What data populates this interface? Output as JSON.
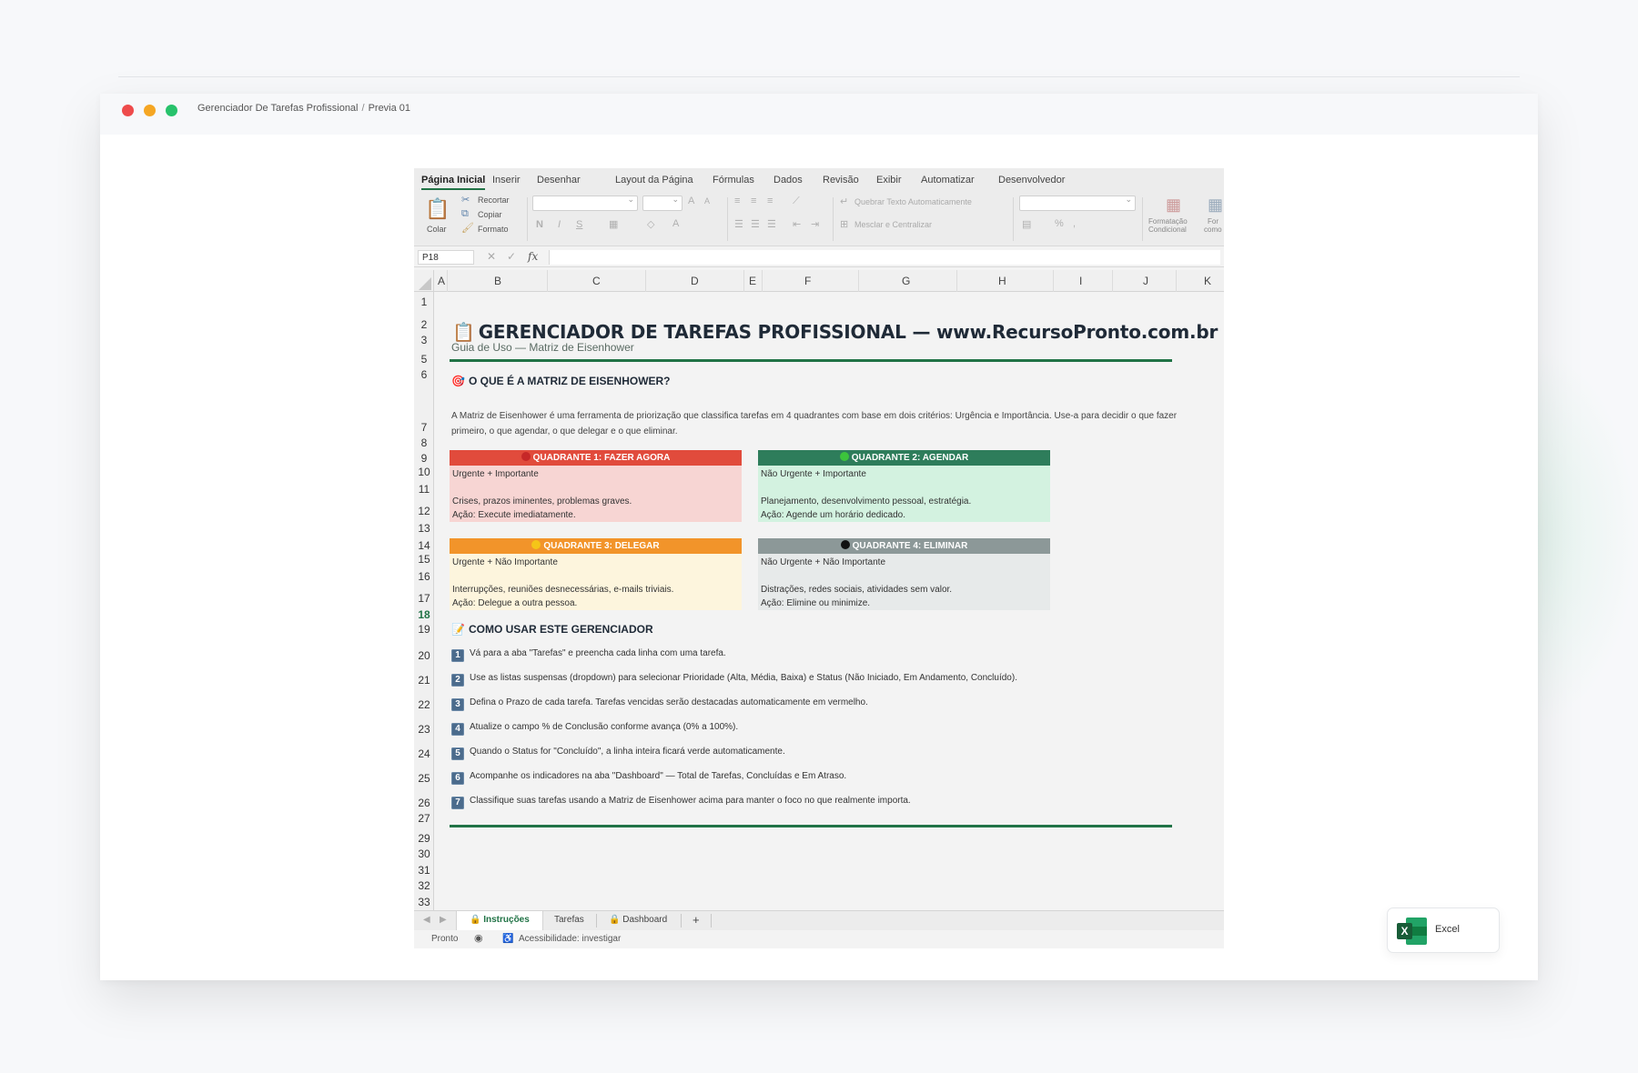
{
  "window": {
    "title": "Gerenciador De Tarefas Profissional",
    "separator": "/",
    "subtitle": "Previa 01"
  },
  "ribbon_tabs": [
    "Página Inicial",
    "Inserir",
    "Desenhar",
    "Layout da Página",
    "Fórmulas",
    "Dados",
    "Revisão",
    "Exibir",
    "Automatizar",
    "Desenvolvedor"
  ],
  "ribbon": {
    "paste": "Colar",
    "cut": "Recortar",
    "copy": "Copiar",
    "format": "Formato",
    "wrap_text": "Quebrar Texto Automaticamente",
    "merge_center": "Mesclar e Centralizar",
    "conditional_formatting_1": "Formatação",
    "conditional_formatting_2": "Condicional",
    "format_as_1": "For",
    "format_as_2": "como"
  },
  "formula_bar": {
    "cell_ref": "P18",
    "fx": "fx"
  },
  "columns": [
    "A",
    "B",
    "C",
    "D",
    "E",
    "F",
    "G",
    "H",
    "I",
    "J",
    "K"
  ],
  "rows": [
    "1",
    "2",
    "3",
    "5",
    "6",
    "7",
    "8",
    "9",
    "10",
    "11",
    "12",
    "13",
    "14",
    "15",
    "16",
    "17",
    "18",
    "19",
    "20",
    "21",
    "22",
    "23",
    "24",
    "25",
    "26",
    "27",
    "29",
    "30",
    "31",
    "32",
    "33"
  ],
  "selected_row": "18",
  "sheet": {
    "title_icon": "📋",
    "title": "GERENCIADOR DE TAREFAS PROFISSIONAL — www.RecursoPronto.com.br",
    "subtitle": "Guia de Uso — Matriz de Eisenhower",
    "section1_icon": "🎯",
    "section1_title": "O QUE É A MATRIZ DE EISENHOWER?",
    "description": "A Matriz de Eisenhower é uma ferramenta de priorização que classifica tarefas em 4 quadrantes com base em dois critérios: Urgência e Importância. Use-a para decidir o que fazer primeiro, o que agendar, o que delegar e o que eliminar.",
    "quadrants": [
      {
        "title": "QUADRANTE 1: FAZER AGORA",
        "line1": "Urgente + Importante",
        "line2": "Crises, prazos iminentes, problemas graves.",
        "line3": "Ação: Execute imediatamente.",
        "header_color": "#e14b3c",
        "body_color": "#f7d5d3",
        "dot_color": "#c62828"
      },
      {
        "title": "QUADRANTE 2: AGENDAR",
        "line1": "Não Urgente + Importante",
        "line2": "Planejamento, desenvolvimento pessoal, estratégia.",
        "line3": "Ação: Agende um horário dedicado.",
        "header_color": "#2e7d5b",
        "body_color": "#d3f2e0",
        "dot_color": "#3cc43c"
      },
      {
        "title": "QUADRANTE 3: DELEGAR",
        "line1": "Urgente + Não Importante",
        "line2": "Interrupções, reuniões desnecessárias, e-mails triviais.",
        "line3": "Ação: Delegue a outra pessoa.",
        "header_color": "#f2942a",
        "body_color": "#fdf5dd",
        "dot_color": "#f5c518"
      },
      {
        "title": "QUADRANTE 4: ELIMINAR",
        "line1": "Não Urgente + Não Importante",
        "line2": "Distrações, redes sociais, atividades sem valor.",
        "line3": "Ação: Elimine ou minimize.",
        "header_color": "#8c9898",
        "body_color": "#e7eaea",
        "dot_color": "#111111"
      }
    ],
    "section2_icon": "📝",
    "section2_title": "COMO USAR ESTE GERENCIADOR",
    "steps": [
      {
        "n": "1",
        "text": "Vá para a aba \"Tarefas\" e preencha cada linha com uma tarefa."
      },
      {
        "n": "2",
        "text": "Use as listas suspensas (dropdown) para selecionar Prioridade (Alta, Média, Baixa) e Status (Não Iniciado, Em Andamento, Concluído)."
      },
      {
        "n": "3",
        "text": "Defina o Prazo de cada tarefa. Tarefas vencidas serão destacadas automaticamente em vermelho."
      },
      {
        "n": "4",
        "text": "Atualize o campo % de Conclusão conforme avança (0% a 100%)."
      },
      {
        "n": "5",
        "text": "Quando o Status for \"Concluído\", a linha inteira ficará verde automaticamente."
      },
      {
        "n": "6",
        "text": "Acompanhe os indicadores na aba \"Dashboard\" — Total de Tarefas, Concluídas e Em Atraso."
      },
      {
        "n": "7",
        "text": "Classifique suas tarefas usando a Matriz de Eisenhower acima para manter o foco no que realmente importa."
      }
    ]
  },
  "sheet_tabs": {
    "tab1": "Instruções",
    "tab2": "Tarefas",
    "tab3": "Dashboard",
    "add": "+"
  },
  "status": {
    "ready": "Pronto",
    "accessibility": "Acessibilidade: investigar"
  },
  "badge": {
    "label": "Excel",
    "logo_letter": "X"
  },
  "colors": {
    "excel_green": "#217346",
    "rule_green": "#217346"
  }
}
